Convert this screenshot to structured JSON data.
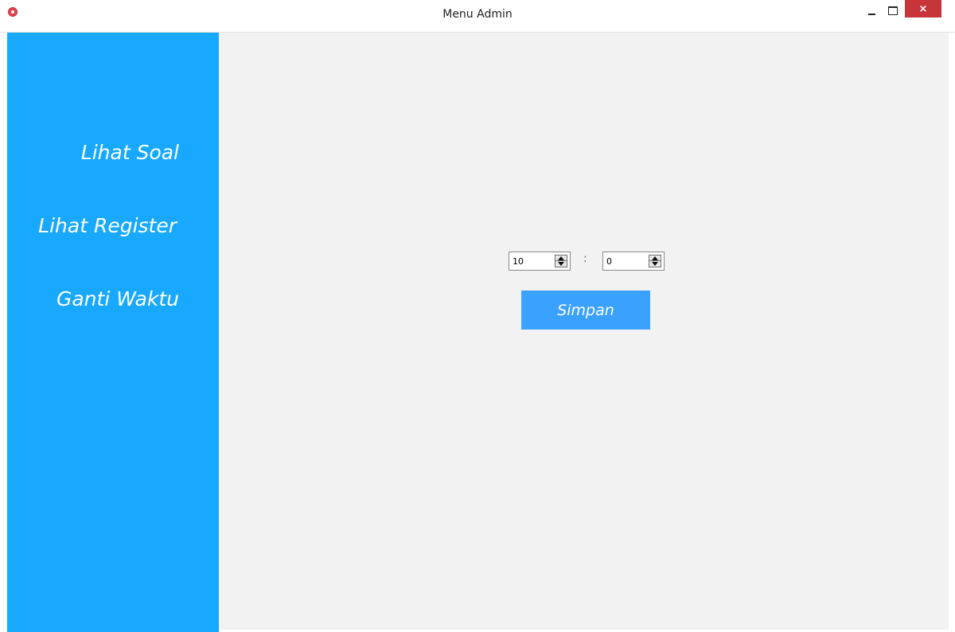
{
  "window": {
    "title": "Menu Admin",
    "close_glyph": "×"
  },
  "icons": {
    "app": "app-logo-icon",
    "minimize": "minimize-icon",
    "maximize": "maximize-icon",
    "close": "close-icon",
    "spin_up": "caret-up-icon",
    "spin_down": "caret-down-icon"
  },
  "colors": {
    "sidebar": "#18a9ff",
    "button": "#3aa1ff",
    "content_bg": "#f2f2f2",
    "close_btn": "#c7343a"
  },
  "sidebar": {
    "items": [
      {
        "label": "Lihat Soal"
      },
      {
        "label": "Lihat Register"
      },
      {
        "label": "Ganti Waktu"
      }
    ]
  },
  "time_form": {
    "minutes": "10",
    "separator": ":",
    "seconds": "0",
    "save_label": "Simpan"
  }
}
